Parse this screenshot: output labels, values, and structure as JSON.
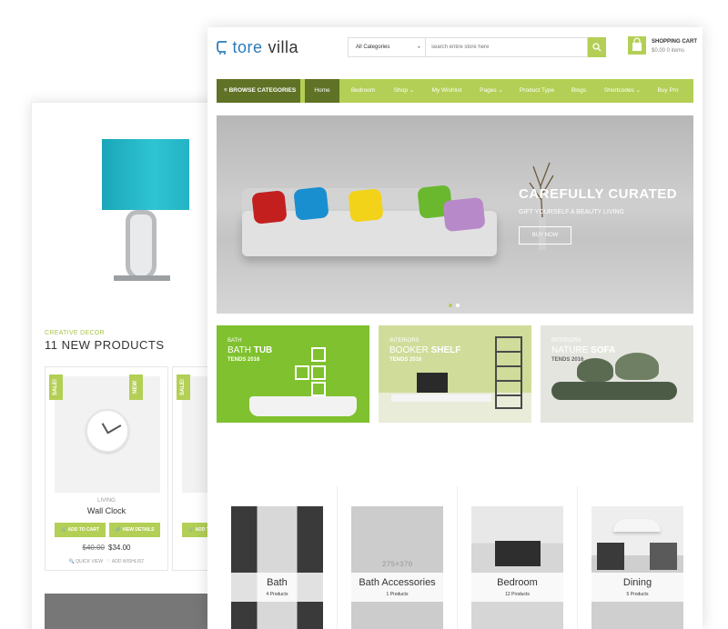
{
  "back_card": {
    "eyebrow": "CREATIVE DECOR",
    "heading": "11 NEW PRODUCTS",
    "product": {
      "badge_sale": "SALE!",
      "badge_new": "NEW",
      "category": "LIVING",
      "name": "Wall Clock",
      "add_to_cart": "ADD TO CART",
      "view_details": "VIEW DETAILS",
      "old_price": "$40.00",
      "price": "$34.00",
      "quick_view": "QUICK VIEW",
      "wishlist": "ADD WISHLIST"
    },
    "product2": {
      "badge_sale": "SALE!",
      "add_to_cart": "ADD TO CART"
    }
  },
  "header": {
    "logo_part1": "tore",
    "logo_part2": "villa",
    "category_select": "All Categories",
    "search_placeholder": "search entire store here",
    "cart_title": "SHOPPING CART",
    "cart_summary": "$0.00 0 items"
  },
  "nav": {
    "browse": "≡ BROWSE CATEGORIES",
    "items": [
      "Home",
      "Bedroom",
      "Shop ⌄",
      "My Wishlist",
      "Pages ⌄",
      "Product Type",
      "Blogs",
      "Shortcodes ⌄",
      "Buy Pro"
    ]
  },
  "hero": {
    "title": "CAREFULLY CURATED",
    "subtitle": "GIFT YOURSELF A BEAUTY LIVING",
    "button": "BUY NOW"
  },
  "banners": [
    {
      "small": "BATH",
      "title_a": "BATH",
      "title_b": "TUB",
      "tag": "TENDS 2016"
    },
    {
      "small": "INTERIORS",
      "title_a": "BOOKER",
      "title_b": "SHELF",
      "tag": "TENDS 2016"
    },
    {
      "small": "INTERIORS",
      "title_a": "NATURE",
      "title_b": "SOFA",
      "tag": "TENDS 2016"
    }
  ],
  "categories": [
    {
      "name": "Bath",
      "count": "4 Products"
    },
    {
      "name": "Bath Accessories",
      "count": "1 Products",
      "placeholder": "275×370"
    },
    {
      "name": "Bedroom",
      "count": "12 Products"
    },
    {
      "name": "Dining",
      "count": "5 Products"
    }
  ],
  "colors": {
    "accent": "#b3cf55",
    "accent_dark": "#5f7226",
    "logo_blue": "#2b7bb8"
  }
}
